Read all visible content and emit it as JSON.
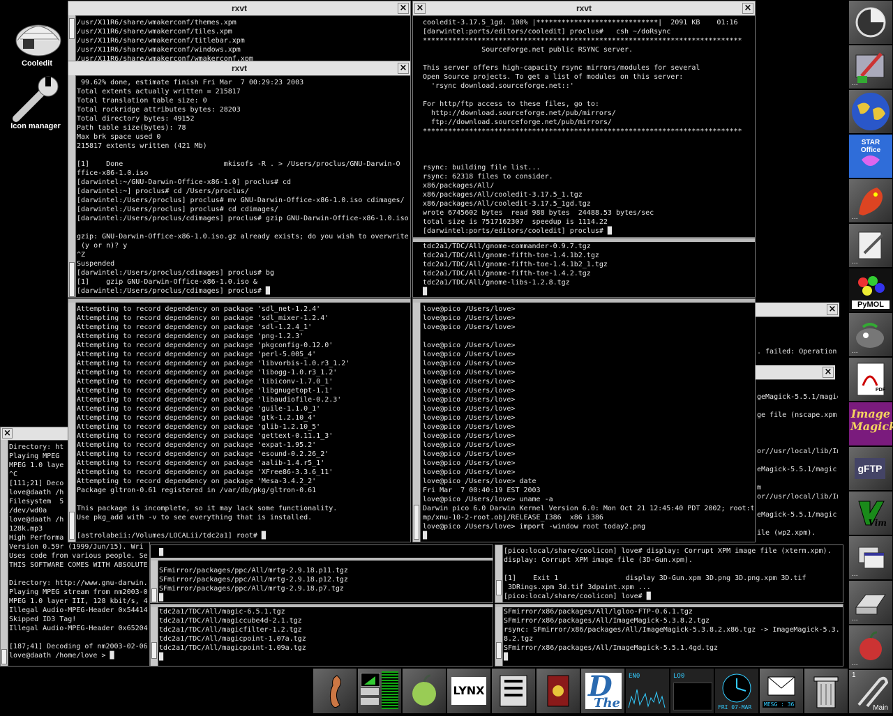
{
  "desktop": {
    "icons": [
      {
        "label": "Cooledit"
      },
      {
        "label": "Icon manager"
      }
    ]
  },
  "windows": {
    "w1": {
      "title": "rxvt",
      "lines": [
        "/usr/X11R6/share/wmakerconf/themes.xpm",
        "/usr/X11R6/share/wmakerconf/tiles.xpm",
        "/usr/X11R6/share/wmakerconf/titlebar.xpm",
        "/usr/X11R6/share/wmakerconf/windows.xpm",
        "/usr/X11R6/share/wmakerconf/wmakerconf.xpm"
      ]
    },
    "w2": {
      "title": "rxvt",
      "lines": [
        " 99.62% done, estimate finish Fri Mar  7 00:29:23 2003",
        "Total extents actually written = 215817",
        "Total translation table size: 0",
        "Total rockridge attributes bytes: 28203",
        "Total directory bytes: 49152",
        "Path table size(bytes): 78",
        "Max brk space used 0",
        "215817 extents written (421 Mb)",
        "",
        "[1]    Done                        mkisofs -R . > /Users/proclus/GNU-Darwin-O",
        "ffice-x86-1.0.iso",
        "[darwintel:~/GNU-Darwin-Office-x86-1.0] proclus# cd",
        "[darwintel:~] proclus# cd /Users/proclus/",
        "[darwintel:/Users/proclus] proclus# mv GNU-Darwin-Office-x86-1.0.iso cdimages/",
        "[darwintel:/Users/proclus] proclus# cd cdimages/",
        "[darwintel:/Users/proclus/cdimages] proclus# gzip GNU-Darwin-Office-x86-1.0.iso",
        "",
        "gzip: GNU-Darwin-Office-x86-1.0.iso.gz already exists; do you wish to overwrite",
        " (y or n)? y",
        "^Z",
        "Suspended",
        "[darwintel:/Users/proclus/cdimages] proclus# bg",
        "[1]    gzip GNU-Darwin-Office-x86-1.0.iso &",
        "[darwintel:/Users/proclus/cdimages] proclus# █"
      ]
    },
    "w3": {
      "title": "rxvt",
      "lines": [
        "cooledit-3.17.5_1gd. 100% |*****************************|  2091 KB    01:16",
        "[darwintel:ports/editors/cooledit] proclus#   csh ~/doRsync",
        "****************************************************************************",
        "              SourceForge.net public RSYNC server.",
        "",
        "This server offers high-capacity rsync mirrors/modules for several",
        "Open Source projects. To get a list of modules on this server:",
        "  'rsync download.sourceforge.net::'",
        "",
        "For http/ftp access to these files, go to:",
        "  http://download.sourceforge.net/pub/mirrors/",
        "  ftp://download.sourceforge.net/pub/mirrors/",
        "****************************************************************************",
        "",
        "",
        "",
        "rsync: building file list...",
        "rsync: 62318 files to consider.",
        "x86/packages/All/",
        "x86/packages/All/cooledit-3.17.5_1.tgz",
        "x86/packages/All/cooledit-3.17.5_1gd.tgz",
        "wrote 6745602 bytes  read 988 bytes  24488.53 bytes/sec",
        "total size is 7517162307  speedup is 1114.22",
        "[darwintel:ports/editors/cooledit] proclus# █"
      ]
    },
    "w4": {
      "lines": [
        "tdc2a1/TDC/All/gnome-commander-0.9.7.tgz",
        "tdc2a1/TDC/All/gnome-fifth-toe-1.4.1b2.tgz",
        "tdc2a1/TDC/All/gnome-fifth-toe-1.4.1b2_1.tgz",
        "tdc2a1/TDC/All/gnome-fifth-toe-1.4.2.tgz",
        "tdc2a1/TDC/All/gnome-libs-1.2.8.tgz",
        "█"
      ]
    },
    "w5": {
      "lines": [
        "Attempting to record dependency on package 'sdl_net-1.2.4'",
        "Attempting to record dependency on package 'sdl_mixer-1.2.4'",
        "Attempting to record dependency on package 'sdl-1.2.4_1'",
        "Attempting to record dependency on package 'png-1.2.3'",
        "Attempting to record dependency on package 'pkgconfig-0.12.0'",
        "Attempting to record dependency on package 'perl-5.005_4'",
        "Attempting to record dependency on package 'libvorbis-1.0.r3_1.2'",
        "Attempting to record dependency on package 'libogg-1.0.r3_1.2'",
        "Attempting to record dependency on package 'libiconv-1.7.0_1'",
        "Attempting to record dependency on package 'libgnugetopt-1.1'",
        "Attempting to record dependency on package 'libaudiofile-0.2.3'",
        "Attempting to record dependency on package 'guile-1.1.0_1'",
        "Attempting to record dependency on package 'gtk-1.2.10_4'",
        "Attempting to record dependency on package 'glib-1.2.10_5'",
        "Attempting to record dependency on package 'gettext-0.11.1_3'",
        "Attempting to record dependency on package 'expat-1.95.2'",
        "Attempting to record dependency on package 'esound-0.2.26_2'",
        "Attempting to record dependency on package 'aalib-1.4.r5_1'",
        "Attempting to record dependency on package 'XFree86-3.3.6_11'",
        "Attempting to record dependency on package 'Mesa-3.4.2_2'",
        "Package gltron-0.61 registered in /var/db/pkg/gltron-0.61",
        "",
        "This package is incomplete, so it may lack some functionality.",
        "Use pkg_add with -v to see everything that is installed.",
        "",
        "[astrolabeii:/Volumes/LOCALii/tdc2a1] root# █"
      ]
    },
    "w6": {
      "lines": [
        "love@pico /Users/love>",
        "love@pico /Users/love>",
        "love@pico /Users/love>",
        "",
        "love@pico /Users/love>",
        "love@pico /Users/love>",
        "love@pico /Users/love>",
        "love@pico /Users/love>",
        "love@pico /Users/love>",
        "love@pico /Users/love>",
        "love@pico /Users/love>",
        "love@pico /Users/love>",
        "love@pico /Users/love>",
        "love@pico /Users/love>",
        "love@pico /Users/love>",
        "love@pico /Users/love>",
        "love@pico /Users/love>",
        "love@pico /Users/love>",
        "love@pico /Users/love>",
        "love@pico /Users/love> date",
        "Fri Mar  7 00:40:19 EST 2003",
        "love@pico /Users/love> uname -a",
        "Darwin pico 6.0 Darwin Kernel Version 6.0: Mon Oct 21 12:45:40 PDT 2002; root:t",
        "mp/xnu-10-2-root.obj/RELEASE_I386  x86 i386",
        "love@pico /Users/love> import -window root today2.png",
        "█"
      ]
    },
    "w7": {
      "lines": [
        ". failed: Operation",
        "",
        "",
        "",
        "",
        "geMagick-5.5.1/magic",
        "",
        "ge file (nscape.xpm)",
        "",
        "",
        "",
        "or//usr/local/lib/Im",
        "",
        "eMagick-5.5.1/magic.",
        "",
        "m",
        "or//usr/local/lib/Im",
        "",
        "eMagick-5.5.1/magic.",
        "",
        "ile (wp2.xpm)."
      ]
    },
    "w8": {
      "lines": [
        "Directory: ht",
        "Playing MPEG",
        "MPEG 1.0 laye",
        "^C",
        "[111;21] Deco",
        "love@daath /h",
        "Filesystem  5",
        "/dev/wd0a",
        "love@daath /h",
        "128k.mp3",
        "High Performa",
        "Version 0.59r (1999/Jun/15). Wri",
        "Uses code from various people. Se",
        "THIS SOFTWARE COMES WITH ABSOLUTE",
        "",
        "Directory: http://www.gnu-darwin.",
        "Playing MPEG stream from nm2003-0",
        "MPEG 1.0 layer III, 128 kbit/s, 4",
        "Illegal Audio-MPEG-Header 0x54414",
        "Skipped ID3 Tag!",
        "Illegal Audio-MPEG-Header 0x65204",
        "",
        "[187;41] Decoding of nm2003-02-06",
        "love@daath /home/love > █"
      ]
    },
    "w9": {
      "lines": [
        "█",
        "",
        "SFmirror/packages/ppc/All/mrtg-2.9.18.p11.tgz",
        "SFmirror/packages/ppc/All/mrtg-2.9.18.p12.tgz",
        "SFmirror/packages/ppc/All/mrtg-2.9.18.p7.tgz",
        "█"
      ]
    },
    "w10": {
      "lines": [
        "[pico:local/share/coolicon] love# display: Corrupt XPM image file (xterm.xpm).",
        "display: Corrupt XPM image file (3D-Gun.xpm).",
        "",
        "[1]    Exit 1                display 3D-Gun.xpm 3D.png 3D.png.xpm 3D.tif",
        " 3DRings.xpm 3d.tif 3dpaint.xpm ...",
        "[pico:local/share/coolicon] love# █"
      ]
    },
    "w11": {
      "lines": [
        "tdc2a1/TDC/All/magic-6.5.1.tgz",
        "tdc2a1/TDC/All/magiccube4d-2.1.tgz",
        "tdc2a1/TDC/All/magicfilter-1.2.tgz",
        "tdc2a1/TDC/All/magicpoint-1.07a.tgz",
        "tdc2a1/TDC/All/magicpoint-1.09a.tgz",
        "█"
      ]
    },
    "w12": {
      "lines": [
        "SFmirror/x86/packages/All/lgloo-FTP-0.6.1.tgz",
        "SFmirror/x86/packages/All/ImageMagick-5.3.8.2.tgz",
        "rsync: SFmirror/x86/packages/All/ImageMagick-5.3.8.2.x86.tgz -> ImageMagick-5.3.",
        "8.2.tgz",
        "SFmirror/x86/packages/All/ImageMagick-5.5.1.4gd.tgz",
        "█"
      ]
    }
  },
  "dock": {
    "tiles": [
      {
        "name": "system-icon"
      },
      {
        "name": "paint-icon"
      },
      {
        "name": "globe-icon"
      },
      {
        "name": "staroffice-icon",
        "label": "STAR Office"
      },
      {
        "name": "mozilla-icon"
      },
      {
        "name": "editor-icon"
      },
      {
        "name": "pymol-icon",
        "label": "PyMOL"
      },
      {
        "name": "gimp-icon"
      },
      {
        "name": "pdf-icon",
        "label": "PDF"
      },
      {
        "name": "imagemagick-icon",
        "label": "Image Magick"
      },
      {
        "name": "gftp-icon",
        "label": "gFTP"
      },
      {
        "name": "vim-icon",
        "label": "Vim"
      },
      {
        "name": "windows-icon"
      },
      {
        "name": "drive-icon"
      },
      {
        "name": "apple-icon"
      }
    ]
  },
  "bottombar": {
    "tiles": [
      {
        "name": "seahorse-icon"
      },
      {
        "name": "meter-icon"
      },
      {
        "name": "apple-green-icon"
      },
      {
        "name": "lynx-icon",
        "label": "LYNX"
      },
      {
        "name": "cde-icon"
      },
      {
        "name": "mailbox-icon"
      },
      {
        "name": "the-icon",
        "label": "The"
      },
      {
        "name": "net-monitor-icon",
        "label": "EN0"
      },
      {
        "name": "net-monitor-2-icon",
        "label": "LO0"
      },
      {
        "name": "clock-icon",
        "date": "FRI 07-MAR"
      },
      {
        "name": "mail-check-icon",
        "label": "MESG : 36"
      },
      {
        "name": "trash-icon"
      },
      {
        "name": "clip-icon",
        "label": "Main",
        "num": "1"
      }
    ]
  }
}
